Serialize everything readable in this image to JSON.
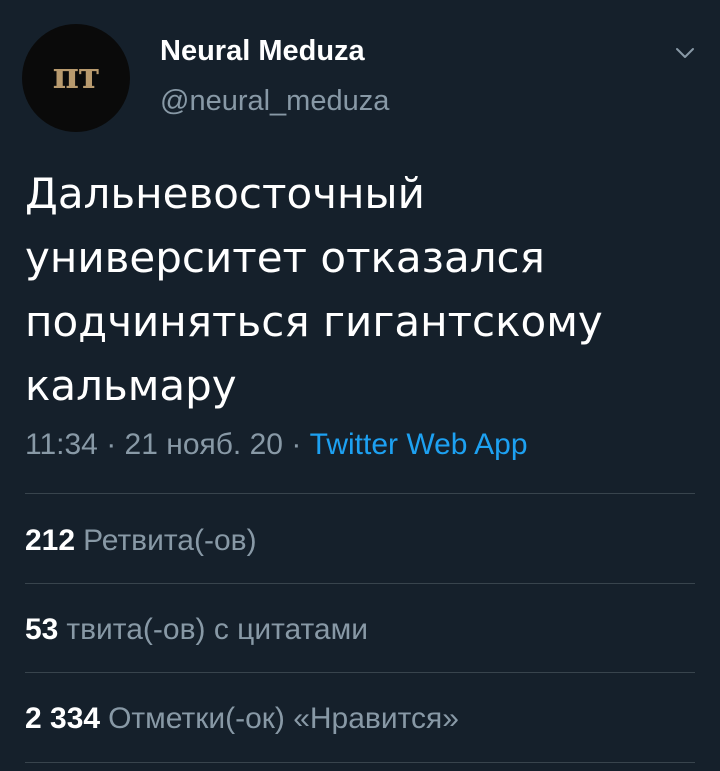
{
  "author": {
    "avatar_text": "пт",
    "display_name": "Neural Meduza",
    "handle": "@neural_meduza"
  },
  "tweet": {
    "text": "Дальневосточный университет отказался подчиняться гигантскому кальмару",
    "time": "11:34",
    "date": "21 нояб. 20",
    "separator": "·",
    "source": "Twitter Web App"
  },
  "stats": {
    "retweets_count": "212",
    "retweets_label": "Ретвита(-ов)",
    "quotes_count": "53",
    "quotes_label": "твита(-ов) с цитатами",
    "likes_count": "2 334",
    "likes_label": "Отметки(-ок) «Нравится»"
  },
  "icons": {
    "more": "chevron-down-icon"
  },
  "colors": {
    "background": "#15202b",
    "text_primary": "#ffffff",
    "text_secondary": "#8899a6",
    "accent": "#1da1f2",
    "divider": "#38444d",
    "avatar_text": "#b89a6e"
  }
}
